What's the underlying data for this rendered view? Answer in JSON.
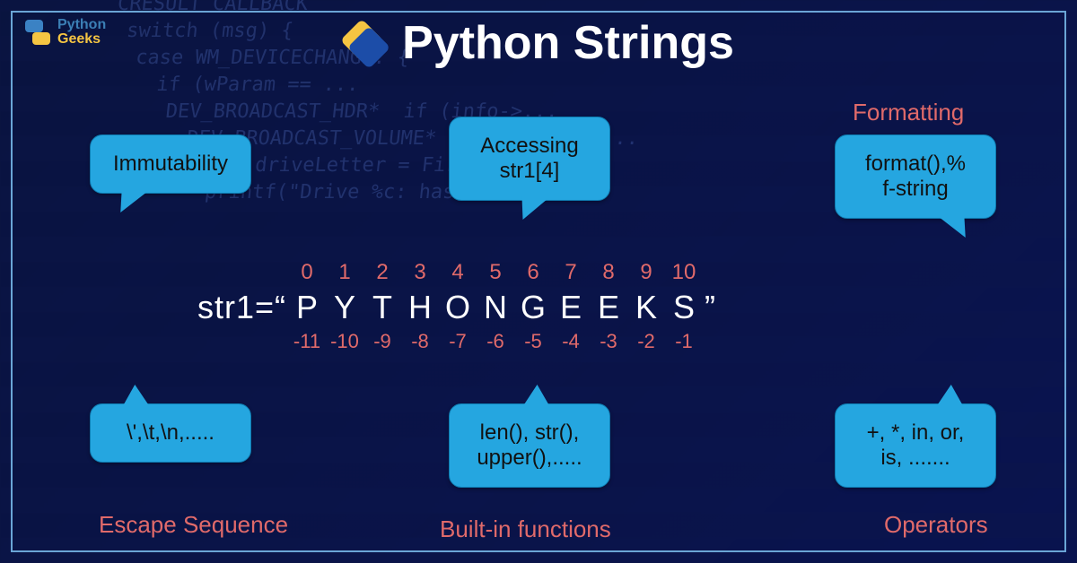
{
  "brand": {
    "line1": "Python",
    "line2": "Geeks"
  },
  "title": "Python Strings",
  "bubbles": {
    "immutability": "Immutability",
    "accessing": "Accessing\nstr1[4]",
    "formatting_body": "format(),%\nf-string",
    "escape": "\\',\\t,\\n,.....",
    "builtins": "len(), str(),\nupper(),.....",
    "operators": "+, *, in, or,\nis, ......."
  },
  "labels": {
    "formatting": "Formatting",
    "escape": "Escape Sequence",
    "builtins": "Built-in functions",
    "operators": "Operators"
  },
  "string_demo": {
    "prefix": "str1=“",
    "chars": [
      "P",
      "Y",
      "T",
      "H",
      "O",
      "N",
      "G",
      "E",
      "E",
      "K",
      "S"
    ],
    "suffix": "”",
    "pos_idx": [
      "0",
      "1",
      "2",
      "3",
      "4",
      "5",
      "6",
      "7",
      "8",
      "9",
      "10"
    ],
    "neg_idx": [
      "-11",
      "-10",
      "-9",
      "-8",
      "-7",
      "-6",
      "-5",
      "-4",
      "-3",
      "-2",
      "-1"
    ]
  },
  "bg_code": "CRESULT CALLBACK\n switch (msg) {\n  case WM_DEVICECHANGE: {\n    if (wParam == ...\n     DEV_BROADCAST_HDR*  if (info->...\n       DEV_BROADCAST_VOLUME* volumeInfo = ...\n        char driveLetter = FirstDrive...\n         printf(\"Drive %c: has been ...\n"
}
